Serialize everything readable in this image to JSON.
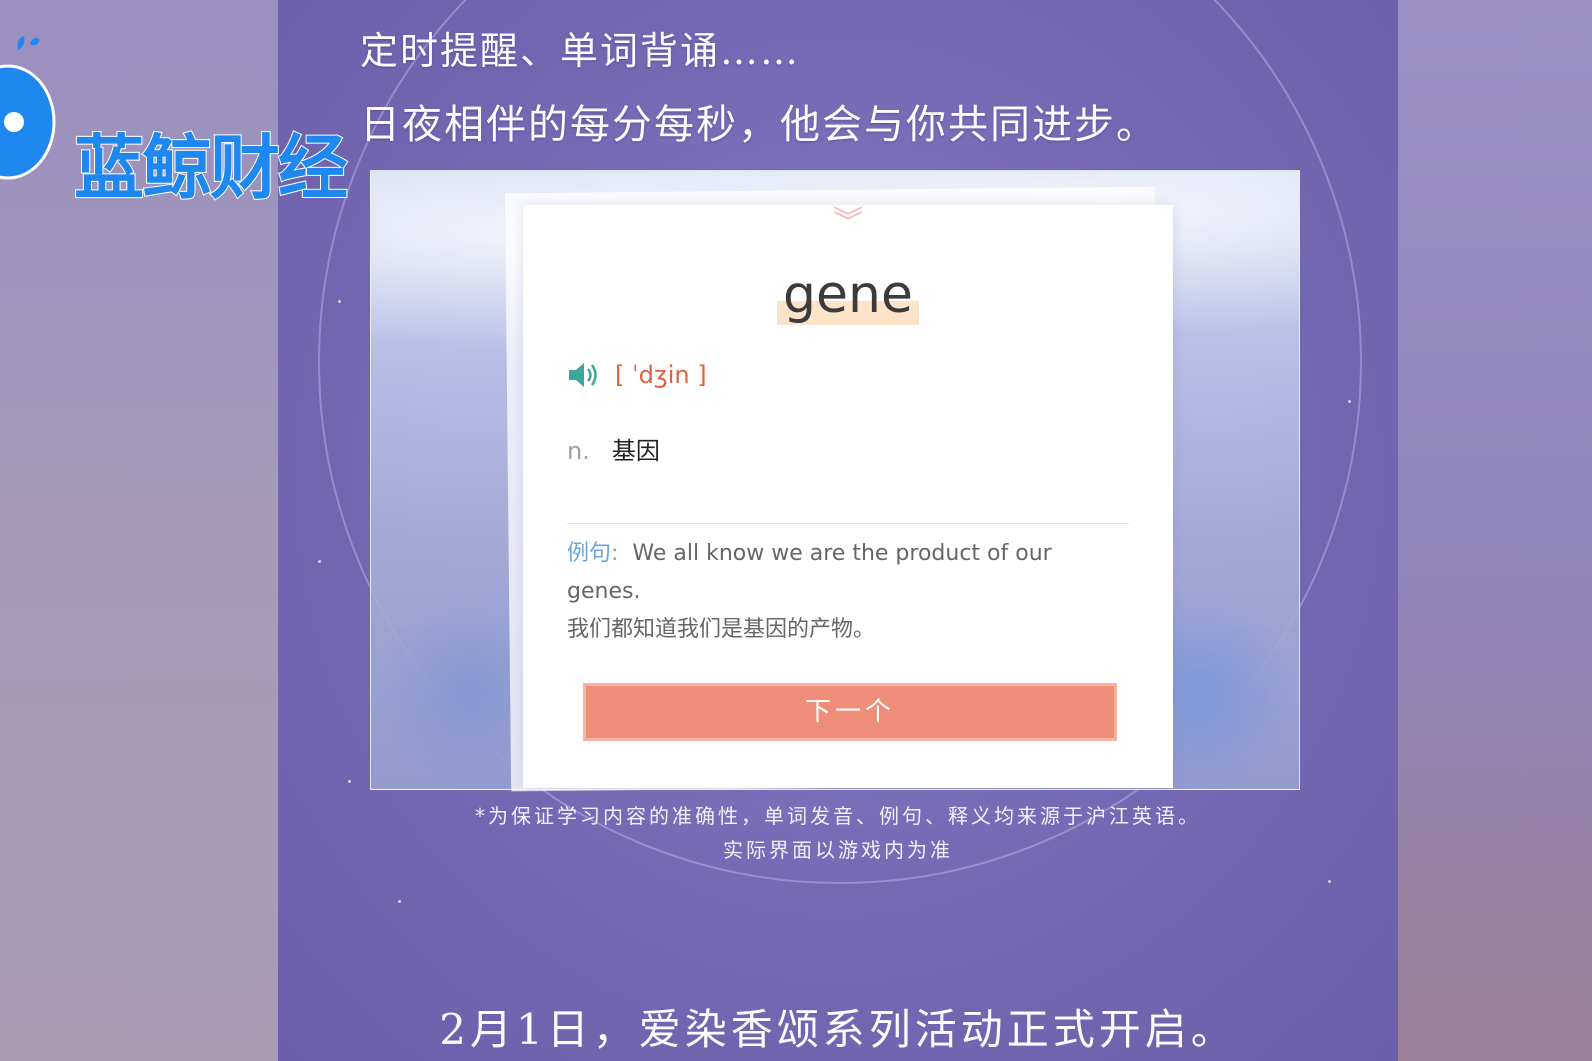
{
  "headline": {
    "line1": "定时提醒、单词背诵……",
    "line2": "日夜相伴的每分每秒，他会与你共同进步。"
  },
  "card": {
    "word": "gene",
    "pronunciation": "[ ˈdʒin ]",
    "part_of_speech": "n.",
    "meaning": "基因",
    "example_label": "例句:",
    "example_en": "We all know we are the product of our genes.",
    "example_zh": "我们都知道我们是基因的产物。",
    "next_button": "下一个",
    "speaker_icon": "speaker-icon"
  },
  "notes": {
    "line1": "*为保证学习内容的准确性，单词发音、例句、释义均来源于沪江英语。",
    "line2": "实际界面以游戏内为准"
  },
  "footer": "2月1日，爱染香颂系列活动正式开启。",
  "watermark": {
    "text": "蓝鲸财经"
  },
  "colors": {
    "accent_button": "#ee8e79",
    "pronunciation": "#e2603c",
    "example_label": "#6aa6d8",
    "watermark": "#1e88f0",
    "background": "#7468b3"
  }
}
